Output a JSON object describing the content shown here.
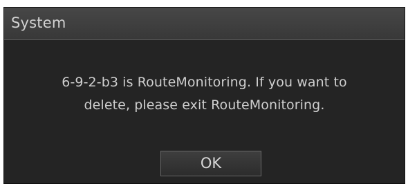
{
  "dialog": {
    "title": "System",
    "message_line1": "6-9-2-b3 is RouteMonitoring. If you want to",
    "message_line2": "delete, please exit RouteMonitoring.",
    "ok_label": "OK"
  },
  "colors": {
    "panel_background": "#242424",
    "titlebar_background": "#404040",
    "text": "#cfcfcf"
  }
}
